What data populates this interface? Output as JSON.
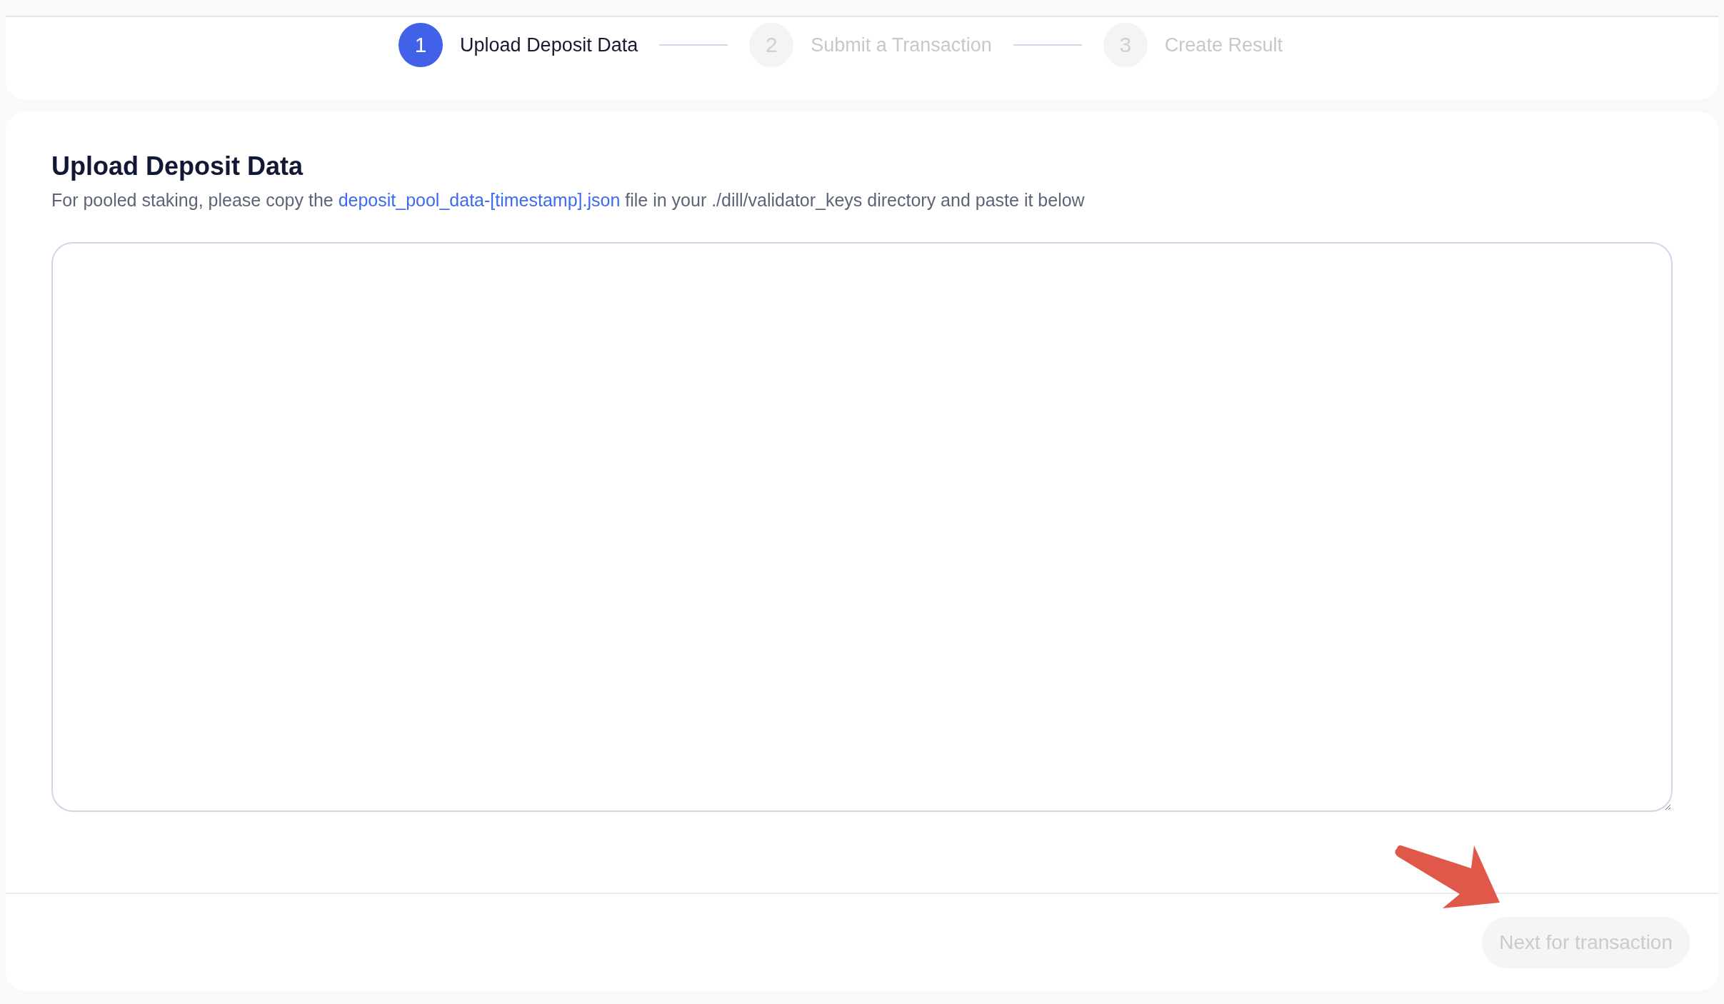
{
  "steps": [
    {
      "number": "1",
      "label": "Upload Deposit Data",
      "selected": true
    },
    {
      "number": "2",
      "label": "Submit a Transaction",
      "selected": false
    },
    {
      "number": "3",
      "label": "Create Result",
      "selected": false
    }
  ],
  "section": {
    "title": "Upload Deposit Data",
    "description_before": "For pooled staking, please copy the ",
    "link": "deposit_pool_data-[timestamp].json",
    "description_after": " file in your ./dill/validator_keys directory and paste it below"
  },
  "next_button": {
    "label": "Next for transaction",
    "disabled": true
  }
}
